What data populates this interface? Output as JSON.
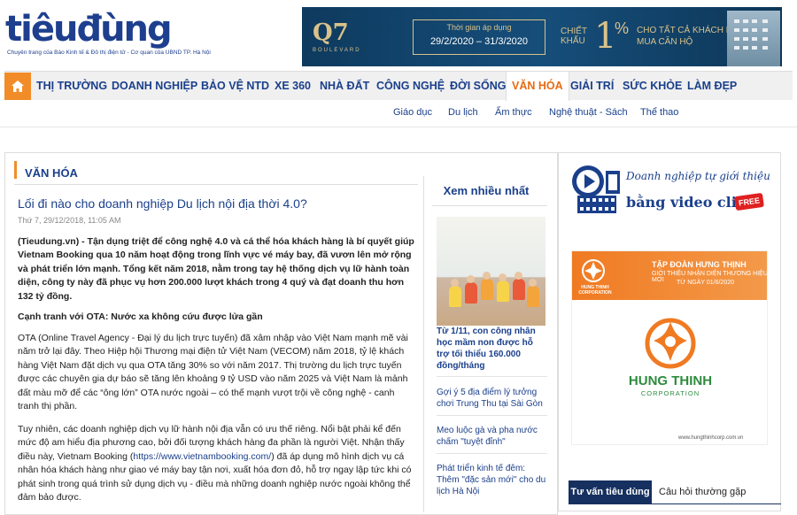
{
  "logo": {
    "text": "tiêuđùng",
    "subtitle": "Chuyên trang của Báo Kinh tế & Đô thị điện tử - Cơ quan của UBND TP. Hà Nội"
  },
  "banner": {
    "brand": "Q7",
    "brand_sub": "BOULEVARD",
    "period_label": "Thời gian áp dụng",
    "period_dates": "29/2/2020 – 31/3/2020",
    "discount_label_1": "CHIẾT",
    "discount_label_2": "KHẤU",
    "discount_value": "1",
    "discount_text_1": "CHO TẤT CẢ KHÁCH HÀNG",
    "discount_text_2": "MUA CĂN HỘ"
  },
  "nav": {
    "items": [
      "THỊ TRƯỜNG",
      "DOANH NGHIỆP",
      "BẢO VỆ NTD",
      "XE 360",
      "NHÀ ĐẤT",
      "CÔNG NGHỆ",
      "ĐỜI SỐNG",
      "VĂN HÓA",
      "GIẢI TRÍ",
      "SỨC KHỎE",
      "LÀM ĐẸP"
    ],
    "active": "VĂN HÓA"
  },
  "subnav": {
    "items": [
      "Giáo dục",
      "Du lịch",
      "Ẩm thực",
      "Nghệ thuật - Sách",
      "Thể thao"
    ]
  },
  "section": {
    "title": "VĂN HÓA"
  },
  "article": {
    "title": "Lối đi nào cho doanh nghiệp Du lịch nội địa thời 4.0?",
    "date": "Thứ 7, 29/12/2018, 11:05 AM",
    "lead": "(Tieudung.vn) - Tận dụng triệt để công nghệ 4.0 và cá thể hóa khách hàng là bí quyết giúp Vietnam Booking qua 10 năm hoạt động trong lĩnh vực vé máy bay, đã vươn lên mở rộng và phát triển lớn mạnh. Tổng kết năm 2018, nằm trong tay hệ thống dịch vụ lữ hành toàn diện, công ty này đã phục vụ hơn 200.000 lượt khách trong 4 quý và đạt doanh thu hơn 132 tỷ đồng.",
    "subhead": "Cạnh tranh với OTA: Nước xa không cứu được lửa gần",
    "para1": "OTA (Online Travel Agency - Đại lý du lịch trực tuyến) đã xâm nhập vào Việt Nam mạnh mẽ vài năm trở lại đây. Theo Hiệp hội Thương mại điện tử Việt Nam (VECOM) năm 2018, tỷ lệ khách hàng Việt Nam đặt dịch vụ qua OTA tăng 30% so với năm 2017. Thị trường du lịch trực tuyến được các chuyên gia dự báo sẽ tăng lên khoảng 9 tỷ USD vào năm 2025 và Việt Nam là mảnh đất màu mỡ để các “ông lớn” OTA nước ngoài – có thế mạnh vượt trội về công nghệ - canh tranh thị phần.",
    "para2_a": "Tuy nhiên, các doanh nghiệp dịch vụ lữ hành nội địa vẫn có ưu thế riêng. Nổi bật phải kể đến mức độ am hiểu địa phương cao, bởi đối tượng khách hàng đa phần là người Việt. Nhận thấy điều này, Vietnam Booking (",
    "para2_link": "https://www.vietnambooking.com/",
    "para2_b": ") đã áp dụng mô hình dịch vụ cá nhân hóa khách hàng như giao vé máy bay tận nơi, xuất hóa đơn đỏ, hỗ trợ ngay lập tức khi có phát sinh trong quá trình sử dụng dịch vụ - điều mà những doanh nghiệp nước ngoài không thể đảm bảo được."
  },
  "most_viewed": {
    "title": "Xem nhiều nhất",
    "items": [
      "Từ 1/11, con công nhân học mầm non được hỗ trợ tối thiểu 160.000 đồng/tháng",
      "Gợi ý 5 địa điểm lý tưởng chơi Trung Thu tại Sài Gòn",
      "Meo luộc gà và pha nước chấm \"tuyệt đỉnh\"",
      "Phát triển kinh tế đêm: Thêm \"đặc sản mới\" cho du lịch Hà Nội"
    ]
  },
  "video_ad": {
    "line1": "Doanh nghiệp tự giới thiệu",
    "line2": "bằng video clip",
    "badge": "FREE"
  },
  "hung_thinh_ad": {
    "brand_small": "HUNG THINH",
    "brand_small_sub": "CORPORATION",
    "headline": "TẬP ĐOÀN HƯNG THỊNH",
    "subline": "GIỚI THIỆU NHẬN DIỆN THƯƠNG HIỆU MỚI",
    "date": "TỪ NGÀY 01/6/2020",
    "name": "HUNG THINH",
    "corp": "CORPORATION",
    "url": "www.hungthinhcorp.com.vn"
  },
  "tabs": {
    "active": "Tư vấn tiêu dùng",
    "other": "Câu hỏi thường gặp"
  },
  "colors": {
    "primary_blue": "#1a3f8b",
    "accent_orange": "#f28c28",
    "green": "#2e8b3e"
  }
}
